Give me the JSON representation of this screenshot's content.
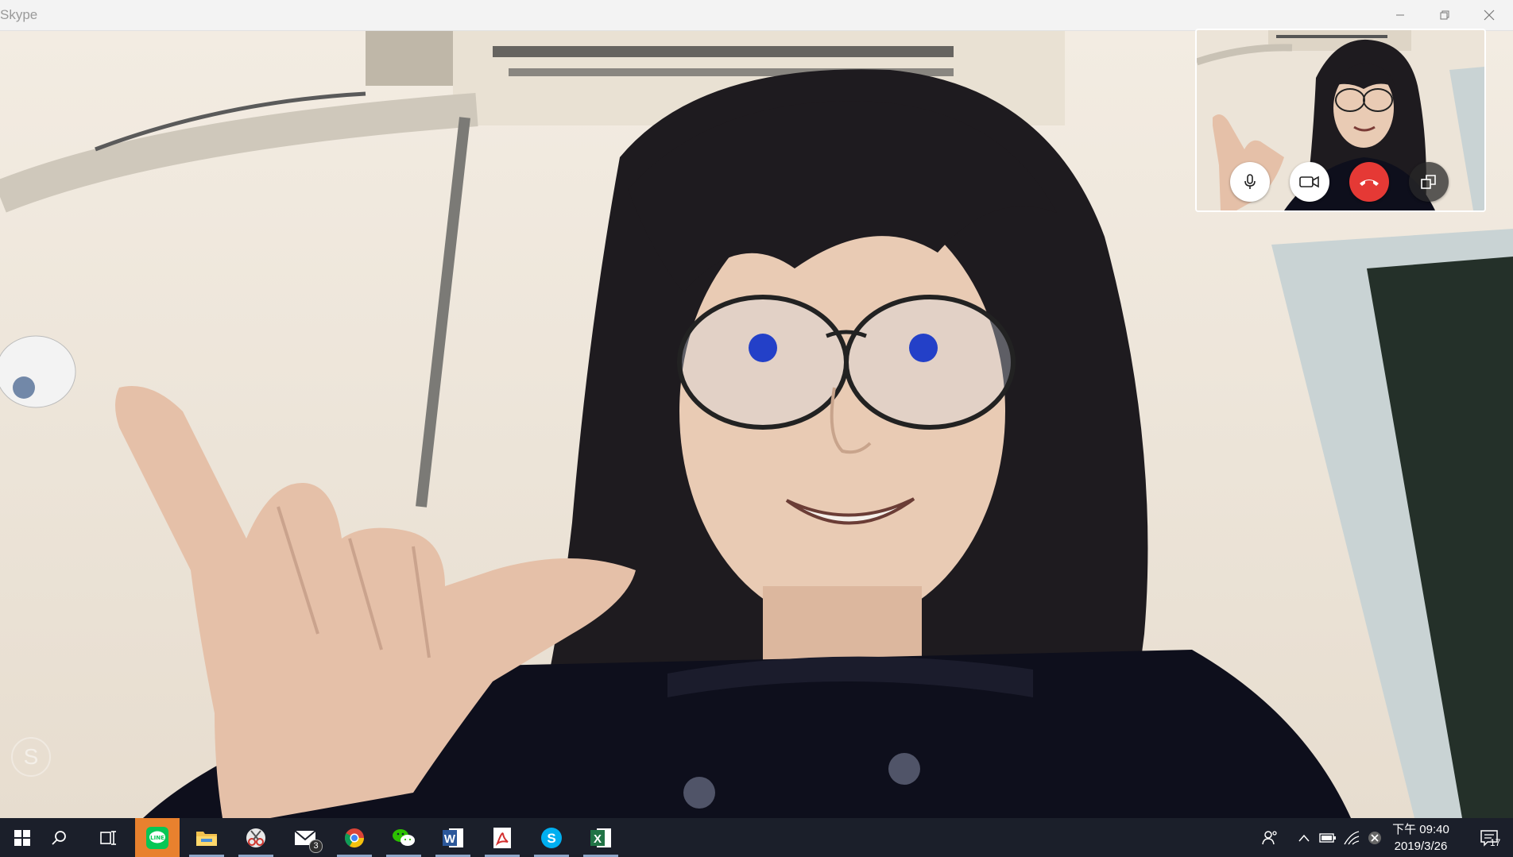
{
  "window": {
    "title": "Skype"
  },
  "call": {
    "remote_video": "remote-participant-video",
    "self_view": "local-camera-preview",
    "controls": {
      "mic": "microphone-icon",
      "camera": "video-camera-icon",
      "hangup": "end-call-icon",
      "switch_view": "switch-view-icon"
    },
    "colors": {
      "hangup": "#e53935",
      "control_bg": "#ffffff"
    }
  },
  "taskbar": {
    "apps": [
      {
        "name": "line",
        "icon": "line-icon"
      },
      {
        "name": "file-explorer",
        "icon": "folder-icon"
      },
      {
        "name": "snipping-tool",
        "icon": "scissors-icon"
      },
      {
        "name": "mail",
        "icon": "mail-icon",
        "badge": "3"
      },
      {
        "name": "chrome",
        "icon": "chrome-icon"
      },
      {
        "name": "wechat",
        "icon": "wechat-icon"
      },
      {
        "name": "word",
        "icon": "word-icon",
        "letter": "W"
      },
      {
        "name": "acrobat",
        "icon": "pdf-icon"
      },
      {
        "name": "skype",
        "icon": "skype-icon",
        "letter": "S"
      },
      {
        "name": "excel",
        "icon": "excel-icon",
        "letter": "X"
      }
    ],
    "clock": {
      "time": "下午 09:40",
      "date": "2019/3/26"
    },
    "notifications": {
      "count": "17"
    },
    "watermark": "S",
    "colors": {
      "active_app": "#e8812e",
      "taskbar_bg": "#1b1f2a"
    }
  }
}
